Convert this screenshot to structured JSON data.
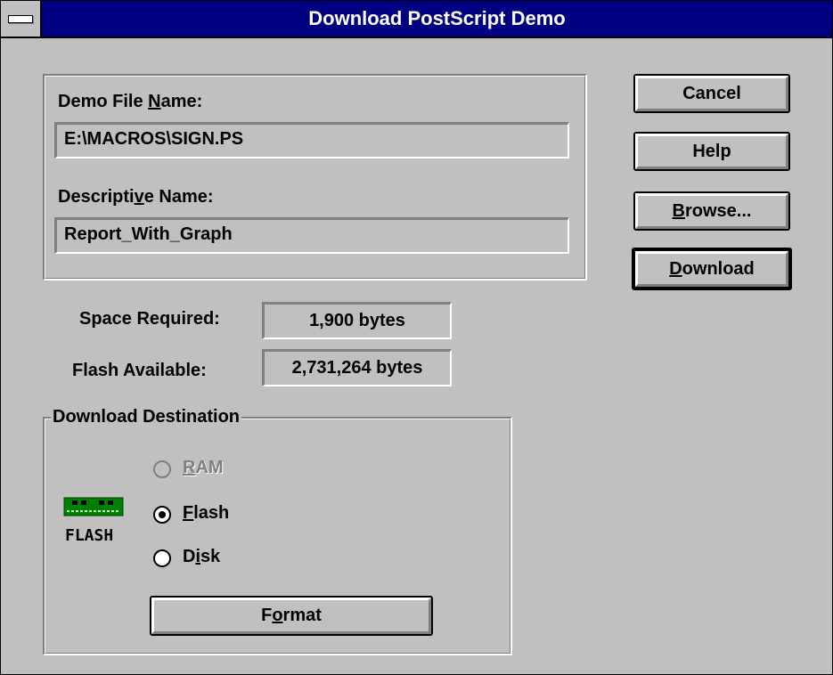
{
  "window": {
    "title": "Download PostScript Demo"
  },
  "file_group": {
    "demo_file_label_pre": "Demo File ",
    "demo_file_label_mn": "N",
    "demo_file_label_post": "ame:",
    "demo_file_value": "E:\\MACROS\\SIGN.PS",
    "desc_label_pre": "Descripti",
    "desc_label_mn": "v",
    "desc_label_post": "e Name:",
    "desc_value": "Report_With_Graph"
  },
  "space": {
    "required_label": "Space Required:",
    "required_value": "1,900 bytes",
    "available_label": "Flash Available:",
    "available_value": "2,731,264 bytes"
  },
  "destination": {
    "legend": "Download Destination",
    "icon_caption": "FLASH",
    "options": [
      {
        "mn": "R",
        "rest": "AM",
        "selected": false,
        "disabled": true
      },
      {
        "mn": "F",
        "rest": "lash",
        "selected": true,
        "disabled": false
      },
      {
        "pre": "D",
        "mn": "i",
        "rest": "sk",
        "selected": false,
        "disabled": false
      }
    ],
    "format_pre": "F",
    "format_mn": "o",
    "format_post": "rmat"
  },
  "buttons": {
    "cancel": "Cancel",
    "help": "Help",
    "browse_mn": "B",
    "browse_rest": "rowse...",
    "download_mn": "D",
    "download_rest": "ownload"
  },
  "colors": {
    "titlebar": "#000080",
    "face": "#c0c0c0",
    "chip": "#008000"
  },
  "icons": {
    "system_menu": "system-menu-icon",
    "flash": "flash-chip-icon"
  }
}
